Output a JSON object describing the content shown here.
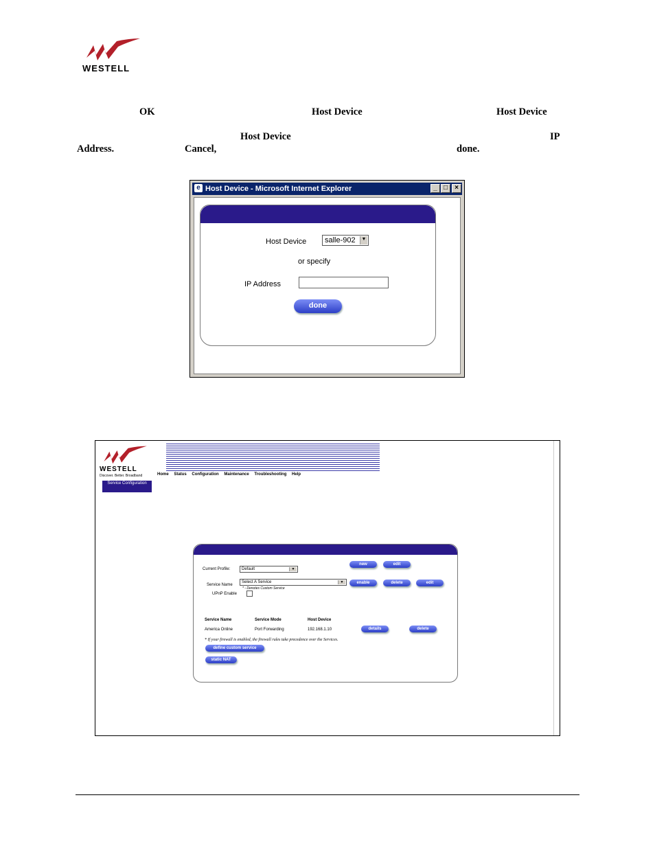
{
  "brand": {
    "name": "WESTELL",
    "tagline": "Discover. Better. Broadband"
  },
  "body_text": {
    "ok": "OK",
    "host_device_1": "Host Device",
    "host_device_2": "Host Device",
    "host_device_3": "Host Device",
    "ip": "IP",
    "address": "Address.",
    "cancel": "Cancel,",
    "done": "done."
  },
  "popup": {
    "title": "Host Device - Microsoft Internet Explorer",
    "host_device_label": "Host Device",
    "host_device_value": "salle-902",
    "or_specify": "or specify",
    "ip_address_label": "IP Address",
    "ip_address_value": "",
    "done_button": "done"
  },
  "router": {
    "nav": [
      "Home",
      "Status",
      "Configuration",
      "Maintenance",
      "Troubleshooting",
      "Help"
    ],
    "side_item": "Service Configuration",
    "current_profile_label": "Current Profile:",
    "current_profile_value": "Default",
    "new_button": "new",
    "edit_button": "edit",
    "service_name_label": "Service Name",
    "service_name_value": "Select A Service",
    "custom_note": "* - Denotes Custom Service",
    "enable_button": "enable",
    "delete_button": "delete",
    "edit_button_2": "edit",
    "upnp_label": "UPnP Enable",
    "table_headers": [
      "Service Name",
      "Service Mode",
      "Host Device"
    ],
    "rows": [
      {
        "name": "America Online",
        "mode": "Port Forwarding",
        "host": "192.168.1.10"
      }
    ],
    "details_button": "details",
    "delete_row_button": "delete",
    "firewall_note": "* If your firewall is enabled, the firewall rules take precedence over the Services.",
    "define_custom_button": "define custom service",
    "static_nat_button": "static NAT"
  }
}
